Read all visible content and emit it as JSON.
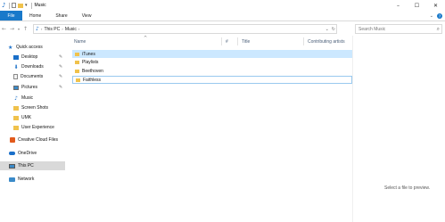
{
  "window": {
    "title": "Music",
    "controls": {
      "minimize": "–",
      "maximize": "☐",
      "close": "✕"
    }
  },
  "ribbon": {
    "tabs": [
      "File",
      "Home",
      "Share",
      "View"
    ],
    "expand": "⌄",
    "help": "?"
  },
  "address": {
    "path": [
      "This PC",
      "Music"
    ],
    "dropdown": "⌄",
    "refresh": "↻"
  },
  "search": {
    "placeholder": "Search Music"
  },
  "sidebar": {
    "items": [
      {
        "label": "Quick access",
        "icon": "star-icon"
      },
      {
        "label": "Desktop",
        "icon": "desktop-icon",
        "pinned": true
      },
      {
        "label": "Downloads",
        "icon": "download-icon",
        "pinned": true
      },
      {
        "label": "Documents",
        "icon": "documents-icon",
        "pinned": true
      },
      {
        "label": "Pictures",
        "icon": "pictures-icon",
        "pinned": true
      },
      {
        "label": "Music",
        "icon": "music-icon"
      },
      {
        "label": "Screen Shots",
        "icon": "folder-icon"
      },
      {
        "label": "UMK",
        "icon": "folder-icon"
      },
      {
        "label": "User Experience",
        "icon": "folder-icon"
      },
      {
        "label": "Creative Cloud Files",
        "icon": "creative-cloud-icon"
      },
      {
        "label": "OneDrive",
        "icon": "onedrive-icon"
      },
      {
        "label": "This PC",
        "icon": "this-pc-icon",
        "selected": true
      },
      {
        "label": "Network",
        "icon": "network-icon"
      }
    ]
  },
  "content": {
    "sort_indicator": "^",
    "columns": {
      "name": "Name",
      "number": "#",
      "title": "Title",
      "contributing": "Contributing artists"
    },
    "rows": [
      {
        "name": "iTunes",
        "state": "selected"
      },
      {
        "name": "Playlists",
        "state": "normal"
      },
      {
        "name": "Beethoven",
        "state": "normal"
      },
      {
        "name": "Faithless",
        "state": "focused"
      }
    ]
  },
  "preview": {
    "message": "Select a file to preview."
  },
  "colors": {
    "accent": "#1979ca",
    "selection": "#cce8ff",
    "folder": "#f0c24c"
  }
}
